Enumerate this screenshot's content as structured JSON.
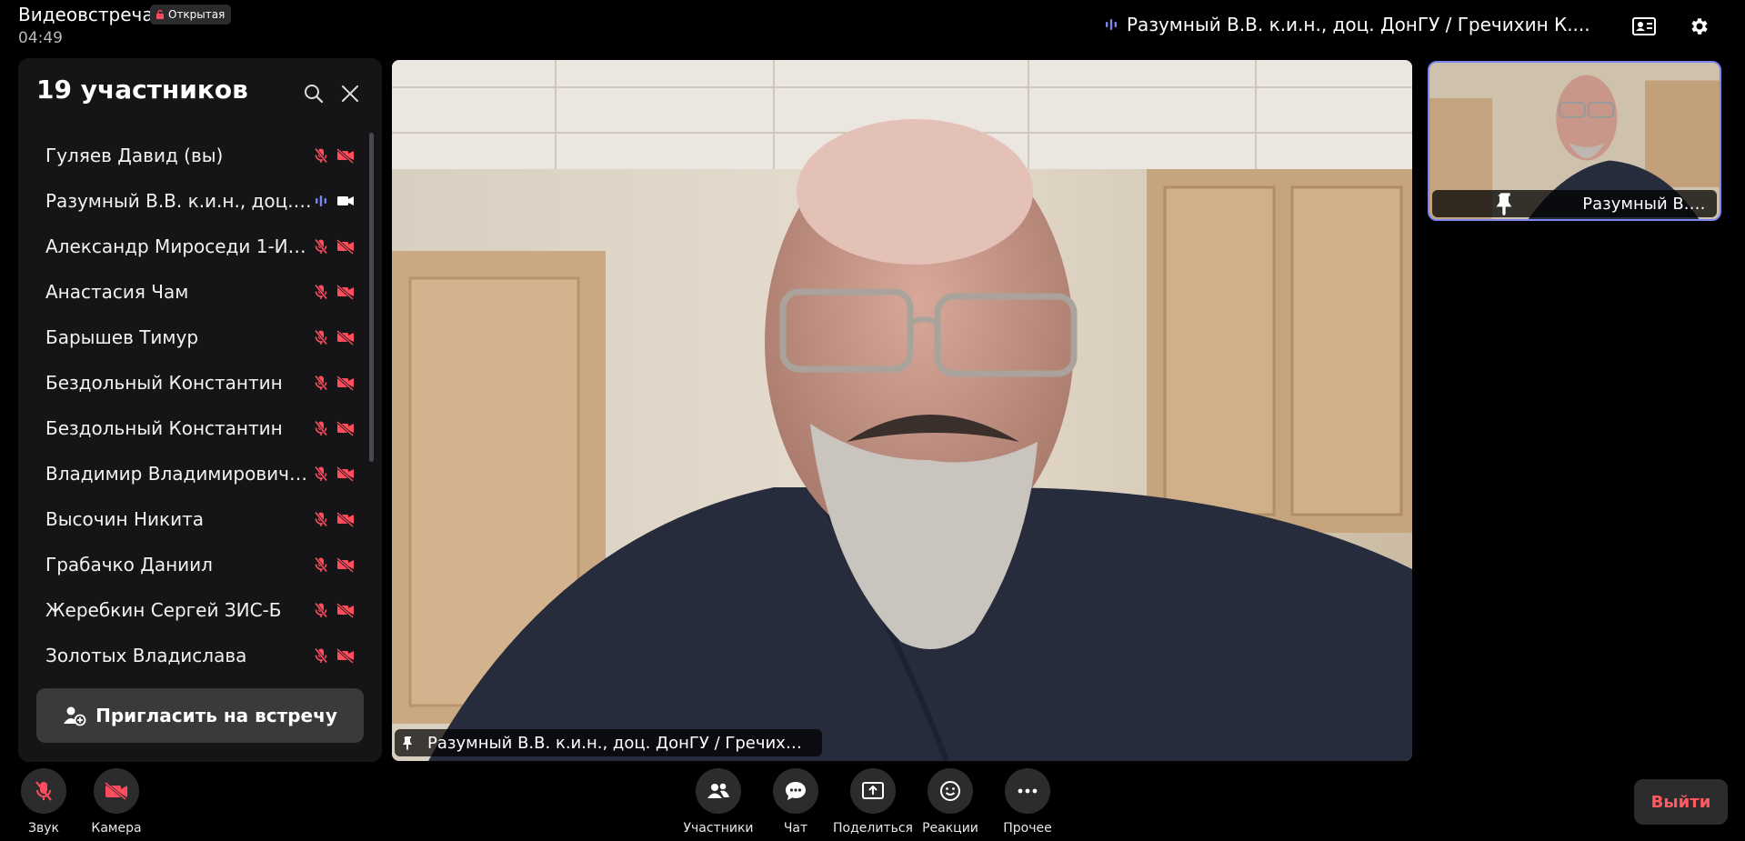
{
  "header": {
    "title": "Видеовстреча",
    "badge": "Открытая",
    "timer": "04:49",
    "active_speaker": "Разумный В.В. к.и.н., доц. ДонГУ / Гречихин К...."
  },
  "participants": {
    "title": "19 участников",
    "invite_label": "Пригласить на встречу",
    "items": [
      {
        "name": "Гуляев Давид (вы)",
        "mic": "off",
        "cam": "off"
      },
      {
        "name": "Разумный В.В. к.и.н., доц. ...",
        "mic": "speaking",
        "cam": "on"
      },
      {
        "name": "Александр Мироседи 1-ИС-А",
        "mic": "off",
        "cam": "off"
      },
      {
        "name": "Анастасия Чам",
        "mic": "off",
        "cam": "off"
      },
      {
        "name": "Барышев Тимур",
        "mic": "off",
        "cam": "off"
      },
      {
        "name": "Бездольный Константин",
        "mic": "off",
        "cam": "off"
      },
      {
        "name": "Бездольный Константин",
        "mic": "off",
        "cam": "off"
      },
      {
        "name": "Владимир Владимирович В...",
        "mic": "off",
        "cam": "off"
      },
      {
        "name": "Высочин Никита",
        "mic": "off",
        "cam": "off"
      },
      {
        "name": "Грабачко Даниил",
        "mic": "off",
        "cam": "off"
      },
      {
        "name": "Жеребкин Сергей ЗИС-Б",
        "mic": "off",
        "cam": "off"
      },
      {
        "name": "Золотых Владислава",
        "mic": "off",
        "cam": "off"
      }
    ]
  },
  "main_video": {
    "label": "Разумный В.В. к.и.н., доц. ДонГУ / Гречихин ..."
  },
  "thumbnail": {
    "label": "Разумный В.В. к.и.н., доц. ..."
  },
  "controls": {
    "sound": "Звук",
    "camera": "Камера",
    "participants": "Участники",
    "chat": "Чат",
    "share": "Поделиться",
    "reactions": "Реакции",
    "more": "Прочее",
    "exit": "Выйти"
  },
  "colors": {
    "muted_red": "#ff4d5e",
    "accent": "#7b86f0",
    "exit_red": "#ff5a5f",
    "panel": "#151517"
  }
}
